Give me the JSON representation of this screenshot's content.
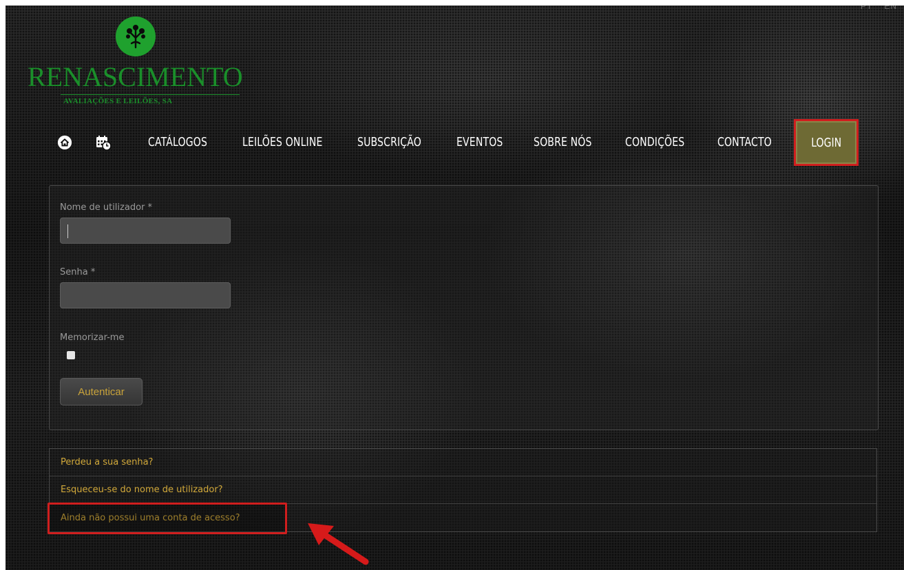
{
  "lang": {
    "pt": "PT",
    "en": "EN"
  },
  "logo": {
    "name": "RENASCIMENTO",
    "subtitle": "AVALIAÇÕES E LEILÕES, SA",
    "icon": "tree-emblem-icon",
    "color": "#1a8f2a"
  },
  "nav": {
    "home_icon": "home-icon",
    "calendar_icon": "calendar-clock-icon",
    "items": [
      {
        "label": "CATÁLOGOS"
      },
      {
        "label": "LEILÕES ONLINE"
      },
      {
        "label": "SUBSCRIÇÃO"
      },
      {
        "label": "EVENTOS"
      },
      {
        "label": "SOBRE NÓS"
      },
      {
        "label": "CONDIÇÕES"
      },
      {
        "label": "CONTACTO"
      }
    ],
    "login_label": "LOGIN"
  },
  "form": {
    "username_label": "Nome de utilizador *",
    "username_value": "",
    "password_label": "Senha *",
    "password_value": "",
    "remember_label": "Memorizar-me",
    "remember_checked": false,
    "submit_label": "Autenticar"
  },
  "links": [
    {
      "label": "Perdeu a sua senha?"
    },
    {
      "label": "Esqueceu-se do nome de utilizador?"
    },
    {
      "label": "Ainda não possui uma conta de acesso?"
    }
  ],
  "colors": {
    "accent_gold": "#d2a93a",
    "login_bg": "#6e6a34",
    "highlight_red": "#d01e1e"
  }
}
